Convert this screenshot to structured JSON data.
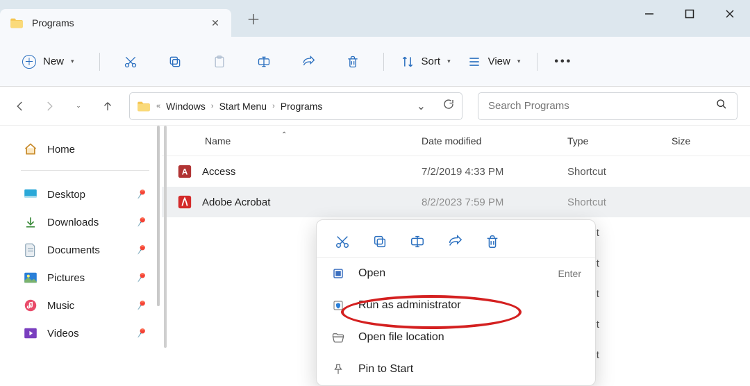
{
  "window": {
    "title": "Programs"
  },
  "toolbar": {
    "new_label": "New",
    "sort_label": "Sort",
    "view_label": "View"
  },
  "nav": {
    "crumbs": [
      "Windows",
      "Start Menu",
      "Programs"
    ],
    "search_placeholder": "Search Programs"
  },
  "sidebar": {
    "home_label": "Home",
    "items": [
      {
        "label": "Desktop"
      },
      {
        "label": "Downloads"
      },
      {
        "label": "Documents"
      },
      {
        "label": "Pictures"
      },
      {
        "label": "Music"
      },
      {
        "label": "Videos"
      }
    ]
  },
  "columns": {
    "name": "Name",
    "date": "Date modified",
    "type": "Type",
    "size": "Size"
  },
  "rows": [
    {
      "name": "Access",
      "date": "7/2/2019 4:33 PM",
      "type": "Shortcut"
    },
    {
      "name": "Adobe Acrobat",
      "date": "8/2/2023 7:59 PM",
      "type": "Shortcut",
      "selected": true
    },
    {
      "name": "",
      "date": "",
      "type": "hortcut"
    },
    {
      "name": "",
      "date": "",
      "type": "hortcut"
    },
    {
      "name": "",
      "date": "",
      "type": "hortcut"
    },
    {
      "name": "",
      "date": "",
      "type": "hortcut"
    },
    {
      "name": "",
      "date": "",
      "type": "hortcut"
    }
  ],
  "context_menu": {
    "open": "Open",
    "open_hint": "Enter",
    "run_admin": "Run as administrator",
    "open_location": "Open file location",
    "pin_start": "Pin to Start"
  }
}
